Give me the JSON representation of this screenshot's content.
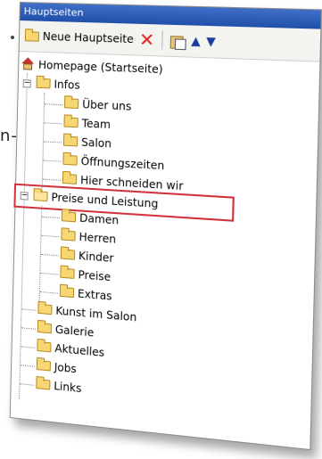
{
  "edge_fragment": "n-",
  "panel": {
    "title": "Hauptseiten",
    "toolbar": {
      "new_page_label": "Neue Hauptseite"
    }
  },
  "tree": {
    "items": [
      {
        "label": "Homepage (Startseite)",
        "icon": "home-icon"
      },
      {
        "label": "Infos",
        "icon": "folder-icon",
        "expanded": true
      },
      {
        "label": "Über uns",
        "icon": "folder-icon"
      },
      {
        "label": "Team",
        "icon": "folder-icon"
      },
      {
        "label": "Salon",
        "icon": "folder-icon"
      },
      {
        "label": "Öffnungszeiten",
        "icon": "folder-icon"
      },
      {
        "label": "Hier schneiden wir",
        "icon": "folder-icon"
      },
      {
        "label": "Preise und Leistung",
        "icon": "folder-open-icon",
        "expanded": true,
        "selected": true
      },
      {
        "label": "Damen",
        "icon": "folder-icon"
      },
      {
        "label": "Herren",
        "icon": "folder-icon"
      },
      {
        "label": "Kinder",
        "icon": "folder-icon"
      },
      {
        "label": "Preise",
        "icon": "folder-icon"
      },
      {
        "label": "Extras",
        "icon": "folder-icon"
      },
      {
        "label": "Kunst im Salon",
        "icon": "folder-icon"
      },
      {
        "label": "Galerie",
        "icon": "folder-icon"
      },
      {
        "label": "Aktuelles",
        "icon": "folder-icon"
      },
      {
        "label": "Jobs",
        "icon": "folder-icon"
      },
      {
        "label": "Links",
        "icon": "folder-icon"
      }
    ]
  },
  "colors": {
    "highlight": "#d1323a",
    "title_bar": "#2a5bb8",
    "delete": "#e0241e",
    "arrows": "#1a3e9c"
  }
}
